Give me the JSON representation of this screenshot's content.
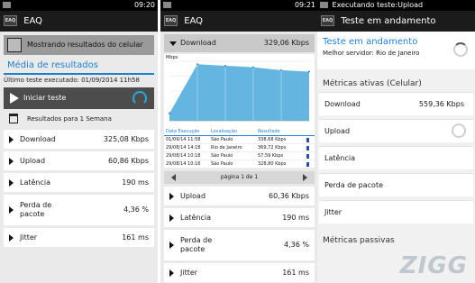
{
  "statusbar": {
    "p1_time": "09:20",
    "p2_time": "09:21",
    "p3_notice": "Executando teste:Upload"
  },
  "app": {
    "title": "EAQ",
    "logo_text": "EAQ"
  },
  "panel1": {
    "banner": "Mostrando resultados do celular",
    "section_title": "Média de resultados",
    "last_test": "Último teste executado: 01/09/2014 11h58",
    "start_button": "Iniciar teste",
    "period": "Resultados para 1 Semana",
    "metrics": [
      {
        "label": "Download",
        "value": "325,08 Kbps"
      },
      {
        "label": "Upload",
        "value": "60,86 Kbps"
      },
      {
        "label": "Latência",
        "value": "190 ms"
      },
      {
        "label": "Perda de pacote",
        "value": "4,36 %"
      },
      {
        "label": "Jitter",
        "value": "161 ms"
      }
    ]
  },
  "panel2": {
    "download_label": "Download",
    "download_value": "329,06 Kbps",
    "chart_unit": "Mbps",
    "table_headers": [
      "Data Execução",
      "Localização",
      "Resultado"
    ],
    "table_rows": [
      [
        "01/09/14 11:58",
        "São Paulo",
        "338,68 Kbps"
      ],
      [
        "29/08/14 14:18",
        "Rio de Janeiro",
        "369,72 Kbps"
      ],
      [
        "29/08/14 10:18",
        "São Paulo",
        "57,59 Kbps"
      ],
      [
        "29/08/14 10:16",
        "São Paulo",
        "328,80 Kbps"
      ]
    ],
    "pager": "página 1 de 1",
    "metrics": [
      {
        "label": "Upload",
        "value": "60,36 Kbps"
      },
      {
        "label": "Latência",
        "value": "190 ms"
      },
      {
        "label": "Perda de pacote",
        "value": "4,36 %"
      },
      {
        "label": "Jitter",
        "value": "161 ms"
      }
    ]
  },
  "panel3": {
    "title": "Teste em andamento",
    "heading": "Teste em andamento",
    "best_server": "Melhor servidor: Rio de Janeiro",
    "active_metrics": "Métricas ativas (Celular)",
    "rows": [
      {
        "label": "Download",
        "value": "559,36 Kbps"
      },
      {
        "label": "Upload",
        "value": ""
      },
      {
        "label": "Latência",
        "value": ""
      },
      {
        "label": "Perda de pacote",
        "value": ""
      },
      {
        "label": "Jitter",
        "value": ""
      }
    ],
    "passive_metrics": "Métricas passivas",
    "watermark": "ZIGG"
  },
  "colors": {
    "accent": "#1f7fcf",
    "chart_fill": "#4aa8dc"
  },
  "chart_data": {
    "type": "area",
    "title": "",
    "ylabel": "Mbps",
    "values": [
      0.05,
      0.38,
      0.37,
      0.36,
      0.34,
      0.33
    ]
  }
}
